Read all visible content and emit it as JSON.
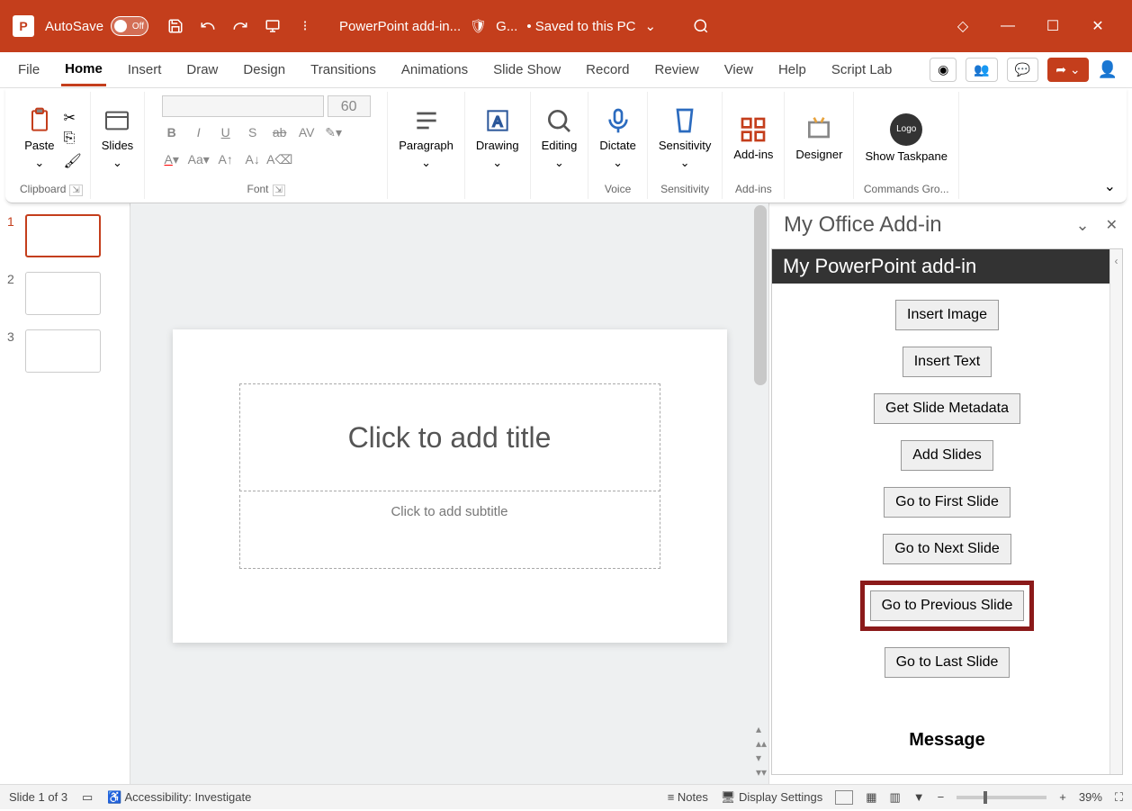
{
  "titlebar": {
    "autosave_label": "AutoSave",
    "autosave_state": "Off",
    "doc_name": "PowerPoint add-in...",
    "guard": "G...",
    "save_state": "• Saved to this PC"
  },
  "tabs": [
    "File",
    "Home",
    "Insert",
    "Draw",
    "Design",
    "Transitions",
    "Animations",
    "Slide Show",
    "Record",
    "Review",
    "View",
    "Help",
    "Script Lab"
  ],
  "active_tab": "Home",
  "ribbon": {
    "clipboard": {
      "paste": "Paste",
      "label": "Clipboard"
    },
    "slides": {
      "btn": "Slides",
      "label": "Slides"
    },
    "font": {
      "size": "60",
      "label": "Font"
    },
    "paragraph": "Paragraph",
    "drawing": "Drawing",
    "editing": "Editing",
    "dictate": "Dictate",
    "voice_label": "Voice",
    "sensitivity": "Sensitivity",
    "sensitivity_label": "Sensitivity",
    "addins": "Add-ins",
    "addins_label": "Add-ins",
    "designer": "Designer",
    "taskpane": "Show Taskpane",
    "commands_label": "Commands Gro...",
    "logo": "Logo"
  },
  "slide": {
    "title_ph": "Click to add title",
    "sub_ph": "Click to add subtitle"
  },
  "thumbs": [
    "1",
    "2",
    "3"
  ],
  "taskpane": {
    "header": "My Office Add-in",
    "banner": "My PowerPoint add-in",
    "buttons": {
      "insert_image": "Insert Image",
      "insert_text": "Insert Text",
      "get_meta": "Get Slide Metadata",
      "add_slides": "Add Slides",
      "go_first": "Go to First Slide",
      "go_next": "Go to Next Slide",
      "go_prev": "Go to Previous Slide",
      "go_last": "Go to Last Slide"
    },
    "message": "Message"
  },
  "status": {
    "slide": "Slide 1 of 3",
    "a11y": "Accessibility: Investigate",
    "notes": "Notes",
    "display": "Display Settings",
    "zoom": "39%"
  }
}
